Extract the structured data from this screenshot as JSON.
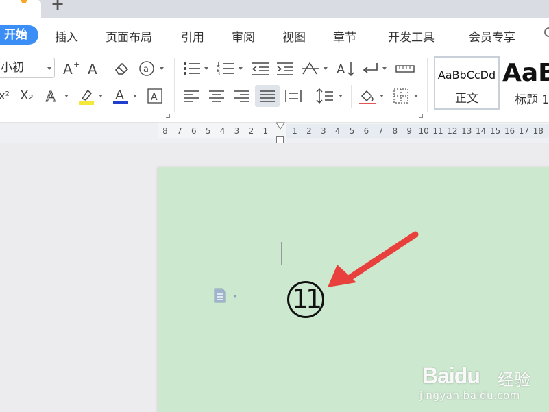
{
  "menu": {
    "items": [
      "开始",
      "插入",
      "页面布局",
      "引用",
      "审阅",
      "视图",
      "章节",
      "开发工具",
      "会员专享"
    ]
  },
  "ribbon": {
    "font_size_value": "小初",
    "styles": {
      "normal_sample": "AaBbCcDd",
      "normal_name": "正文",
      "heading_sample": "AaB",
      "heading_name": "标题 1"
    }
  },
  "ruler": {
    "left_ticks": [
      "8",
      "7",
      "6",
      "5",
      "4",
      "3",
      "2",
      "1"
    ],
    "right_ticks": [
      "1",
      "2",
      "3",
      "4",
      "5",
      "6",
      "7",
      "8",
      "9",
      "10",
      "11",
      "12",
      "13",
      "14",
      "15",
      "16",
      "17",
      "18"
    ]
  },
  "document": {
    "content": "11"
  },
  "colors": {
    "accent": "#3a8ef6",
    "page_background": "#cce8cf",
    "arrow": "#e8403c",
    "highlight": "#f4e93b",
    "font_color": "#1f3fcc"
  },
  "watermark": {
    "brand": "Baidu",
    "product": "经验",
    "url": "jingyan.baidu.com"
  }
}
